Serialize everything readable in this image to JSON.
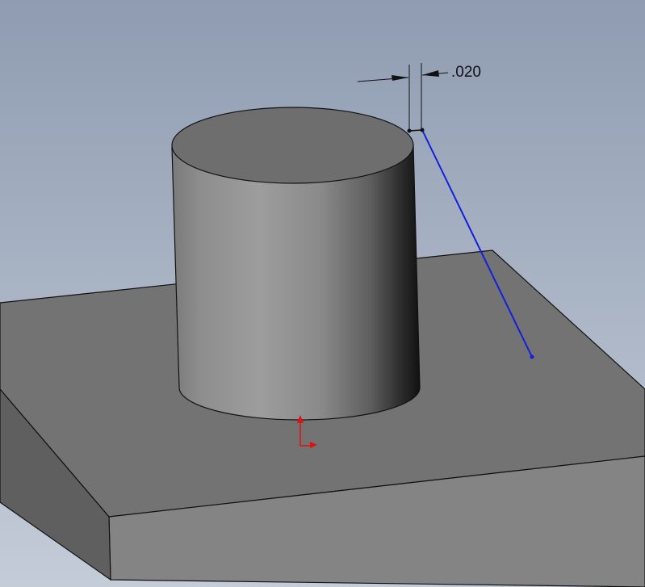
{
  "viewport": {
    "background_top": "#8f9cb1",
    "background_bottom": "#c4ccd8"
  },
  "dimension": {
    "value": ".020"
  },
  "colors": {
    "sketch_line": "#1020e0",
    "origin": "#e01010",
    "plate_top": "#737373",
    "plate_front": "#838383",
    "plate_side": "#5e5e5e"
  }
}
